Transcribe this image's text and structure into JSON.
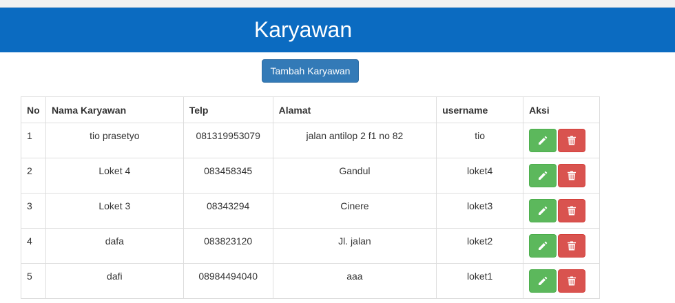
{
  "page": {
    "title": "Karyawan",
    "add_button_label": "Tambah Karyawan"
  },
  "colors": {
    "header_bg": "#0b6bc1",
    "primary_button": "#337ab7",
    "edit_button": "#5cb85c",
    "delete_button": "#d9534f"
  },
  "table": {
    "headers": {
      "no": "No",
      "nama": "Nama Karyawan",
      "telp": "Telp",
      "alamat": "Alamat",
      "username": "username",
      "aksi": "Aksi"
    },
    "rows": [
      {
        "no": "1",
        "nama": "tio prasetyo",
        "telp": "081319953079",
        "alamat": "jalan antilop 2 f1 no 82",
        "username": "tio"
      },
      {
        "no": "2",
        "nama": "Loket 4",
        "telp": "083458345",
        "alamat": "Gandul",
        "username": "loket4"
      },
      {
        "no": "3",
        "nama": "Loket 3",
        "telp": "08343294",
        "alamat": "Cinere",
        "username": "loket3"
      },
      {
        "no": "4",
        "nama": "dafa",
        "telp": "083823120",
        "alamat": "Jl. jalan",
        "username": "loket2"
      },
      {
        "no": "5",
        "nama": "dafi",
        "telp": "08984494040",
        "alamat": "aaa",
        "username": "loket1"
      }
    ],
    "row_actions": [
      "pencil-icon",
      "trash-icon"
    ]
  }
}
